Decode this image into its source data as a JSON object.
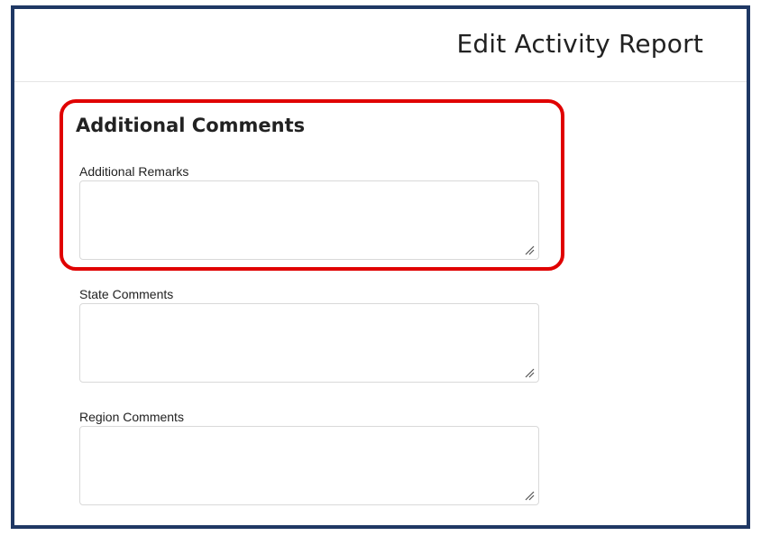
{
  "header": {
    "title": "Edit Activity Report"
  },
  "section": {
    "title": "Additional Comments"
  },
  "fields": [
    {
      "label": "Additional Remarks",
      "value": ""
    },
    {
      "label": "State Comments",
      "value": ""
    },
    {
      "label": "Region Comments",
      "value": ""
    }
  ],
  "colors": {
    "frame_border": "#1f3864",
    "highlight": "#e00000"
  }
}
